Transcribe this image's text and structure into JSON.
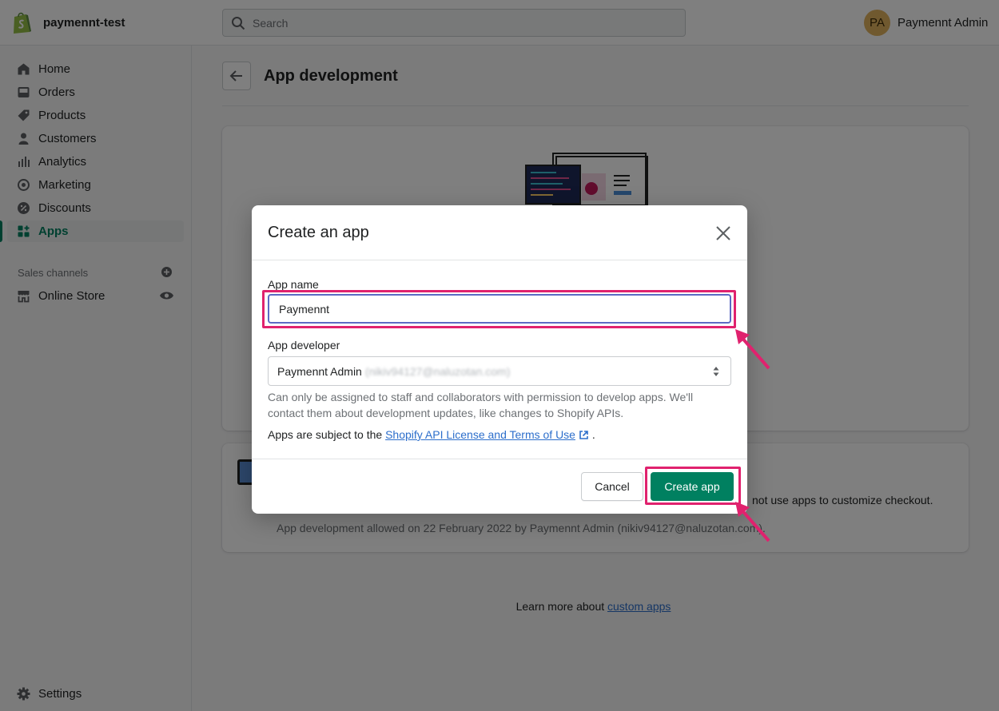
{
  "topbar": {
    "store_name": "paymennt-test",
    "search_placeholder": "Search",
    "avatar_initials": "PA",
    "user_name": "Paymennt Admin"
  },
  "sidebar": {
    "items": [
      {
        "label": "Home",
        "icon": "home-icon"
      },
      {
        "label": "Orders",
        "icon": "orders-icon"
      },
      {
        "label": "Products",
        "icon": "tag-icon"
      },
      {
        "label": "Customers",
        "icon": "person-icon"
      },
      {
        "label": "Analytics",
        "icon": "bar-chart-icon"
      },
      {
        "label": "Marketing",
        "icon": "target-icon"
      },
      {
        "label": "Discounts",
        "icon": "discount-icon"
      },
      {
        "label": "Apps",
        "icon": "apps-icon"
      }
    ],
    "active_item": "Apps",
    "sales_channels_label": "Sales channels",
    "online_store": {
      "label": "Online Store",
      "icon": "store-icon"
    },
    "settings": {
      "label": "Settings",
      "icon": "gear-icon"
    }
  },
  "page": {
    "title": "App development",
    "card2_text": "not use apps to customize checkout.",
    "card2_note": "App development allowed on 22 February 2022 by Paymennt Admin (nikiv94127@naluzotan.com).",
    "learn_more_prefix": "Learn more about ",
    "learn_more_link": "custom apps"
  },
  "modal": {
    "title": "Create an app",
    "app_name_label": "App name",
    "app_name_value": "Paymennt",
    "app_developer_label": "App developer",
    "app_developer_value": "Paymennt Admin",
    "app_developer_email": "(nikiv94127@naluzotan.com)",
    "help_text": "Can only be assigned to staff and collaborators with permission to develop apps. We'll contact them about development updates, like changes to Shopify APIs.",
    "terms_prefix": "Apps are subject to the ",
    "terms_link": "Shopify API License and Terms of Use",
    "terms_suffix": " .",
    "cancel_label": "Cancel",
    "create_label": "Create app"
  },
  "colors": {
    "accent": "#008060",
    "highlight": "#e0226e",
    "link": "#2c6ecb",
    "focus": "#5c6ac4"
  }
}
